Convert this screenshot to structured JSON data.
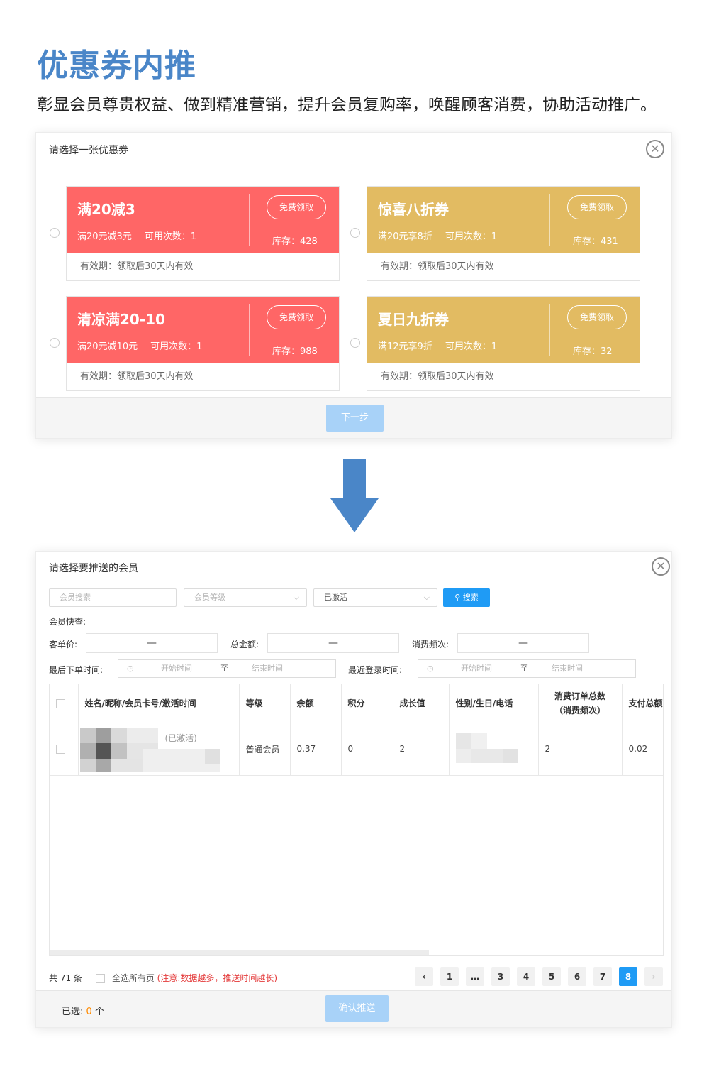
{
  "hero": {
    "title": "优惠券内推",
    "subtitle": "彰显会员尊贵权益、做到精准营销，提升会员复购率，唤醒顾客消费，协助活动推广。"
  },
  "coupon_dialog": {
    "title": "请选择一张优惠券",
    "close_symbol": "✕",
    "claim_label": "免费领取",
    "next_label": "下一步",
    "coupons": [
      {
        "name": "满20减3",
        "rule": "满20元减3元",
        "uses": "可用次数：1",
        "stock": "库存：428",
        "valid": "有效期：领取后30天内有效",
        "color": "#ff6666"
      },
      {
        "name": "惊喜八折券",
        "rule": "满20元享8折",
        "uses": "可用次数：1",
        "stock": "库存：431",
        "valid": "有效期：领取后30天内有效",
        "color": "#e2bb62"
      },
      {
        "name": "清凉满20-10",
        "rule": "满20元减10元",
        "uses": "可用次数：1",
        "stock": "库存：988",
        "valid": "有效期：领取后30天内有效",
        "color": "#ff6666"
      },
      {
        "name": "夏日九折券",
        "rule": "满12元享9折",
        "uses": "可用次数：1",
        "stock": "库存：32",
        "valid": "有效期：领取后30天内有效",
        "color": "#e2bb62"
      }
    ]
  },
  "member_dialog": {
    "title": "请选择要推送的会员",
    "close_symbol": "✕",
    "search_placeholder": "会员搜索",
    "level_placeholder": "会员等级",
    "status_value": "已激活",
    "search_label": "搜索",
    "quick_label": "会员快查:",
    "avg_price_label": "客单价:",
    "total_amount_label": "总金额:",
    "frequency_label": "消费频次:",
    "dash": "—",
    "last_order_label": "最后下单时间:",
    "last_login_label": "最近登录时间:",
    "start_time": "开始时间",
    "to": "至",
    "end_time": "结束时间",
    "columns": [
      "姓名/昵称/会员卡号/激活时间",
      "等级",
      "余额",
      "积分",
      "成长值",
      "性别/生日/电话",
      "消费订单总数\n（消费频次）",
      "支付总额"
    ],
    "row": {
      "status": "(已激活)",
      "level": "普通会员",
      "balance": "0.37",
      "points": "0",
      "growth": "2",
      "orders": "2",
      "paid": "0.02"
    },
    "total_text": "共 71 条",
    "select_all_label": "全选所有页",
    "select_all_warning": "(注意:数据越多，推送时间越长)",
    "pagination": {
      "prev": "‹",
      "next": "›",
      "pages": [
        "1",
        "…",
        "3",
        "4",
        "5",
        "6",
        "7",
        "8"
      ],
      "current": "8"
    },
    "selected_prefix": "已选:",
    "selected_count": "0",
    "selected_suffix": "个",
    "confirm_label": "确认推送"
  },
  "colors": {
    "accent": "#4a86c8",
    "primary_button": "#1f9bf5",
    "disabled_button": "#a8d2f8",
    "red_coupon": "#ff6666",
    "gold_coupon": "#e2bb62",
    "warning": "#e43a3a",
    "selected_count": "#ff8a00"
  },
  "icons": [
    "close-circle-icon",
    "chevron-down-icon",
    "search-icon",
    "clock-icon",
    "down-arrow-icon"
  ]
}
